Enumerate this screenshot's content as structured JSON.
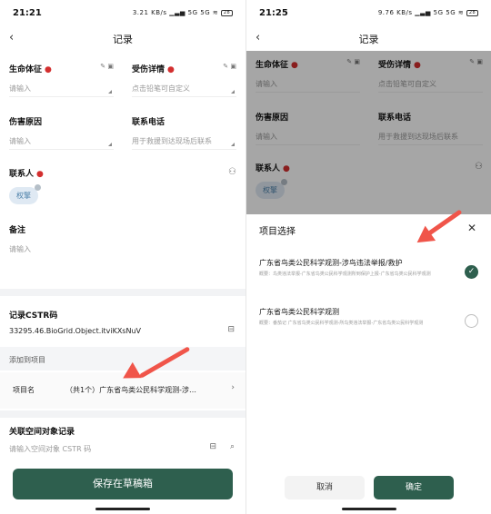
{
  "left": {
    "status": {
      "time": "21:21",
      "speed": "3.21 KB/s",
      "network": "5G 5G",
      "battery": "28"
    },
    "nav": {
      "title": "记录"
    },
    "fields": {
      "vital_signs": {
        "label": "生命体征",
        "placeholder": "请输入"
      },
      "injury_detail": {
        "label": "受伤详情",
        "placeholder": "点击铅笔可自定义"
      },
      "injury_cause": {
        "label": "伤害原因",
        "placeholder": "请输入"
      },
      "phone": {
        "label": "联系电话",
        "placeholder": "用于救援到达现场后联系"
      },
      "contact": {
        "label": "联系人",
        "chip": "权擎"
      },
      "notes": {
        "label": "备注",
        "placeholder": "请输入"
      }
    },
    "cstr": {
      "label": "记录CSTR码",
      "value": "33295.46.BioGrid.Object.itviKXsNuV"
    },
    "project": {
      "add_label": "添加到项目",
      "name_label": "项目名",
      "value": "（共1个）广东省鸟类公民科学观测-涉…"
    },
    "spatial": {
      "label": "关联空间对象记录",
      "placeholder": "请输入空间对象 CSTR 码"
    },
    "save_label": "保存在草稿箱"
  },
  "right": {
    "status": {
      "time": "21:25",
      "speed": "9.76 KB/s",
      "network": "5G 5G",
      "battery": "28"
    },
    "nav": {
      "title": "记录"
    },
    "fields": {
      "vital_signs": {
        "label": "生命体征",
        "placeholder": "请输入"
      },
      "injury_detail": {
        "label": "受伤详情",
        "placeholder": "点击铅笔可自定义"
      },
      "injury_cause": {
        "label": "伤害原因",
        "placeholder": "请输入"
      },
      "phone": {
        "label": "联系电话",
        "placeholder": "用于救援到达现场后联系"
      },
      "contact": {
        "label": "联系人",
        "chip": "权擎"
      }
    },
    "sheet": {
      "title": "项目选择",
      "options": [
        {
          "title": "广东省鸟类公民科学观测-涉鸟违法举报/救护",
          "desc": "概要：鸟类违法举报-广东省鸟类公民科学观测所到保护上报-广东省鸟类公民科学观测",
          "selected": true
        },
        {
          "title": "广东省鸟类公民科学观测",
          "desc": "概要：番茄记 广东省鸟类公民科学观测-所鸟类违法举报-广东省鸟类公民科学观测",
          "selected": false
        }
      ],
      "cancel_label": "取消",
      "confirm_label": "确定"
    }
  },
  "colors": {
    "accent": "#2e5f4e",
    "required": "#d32f2f",
    "arrow": "#f0554a",
    "chip_bg": "#dfe9f3"
  }
}
